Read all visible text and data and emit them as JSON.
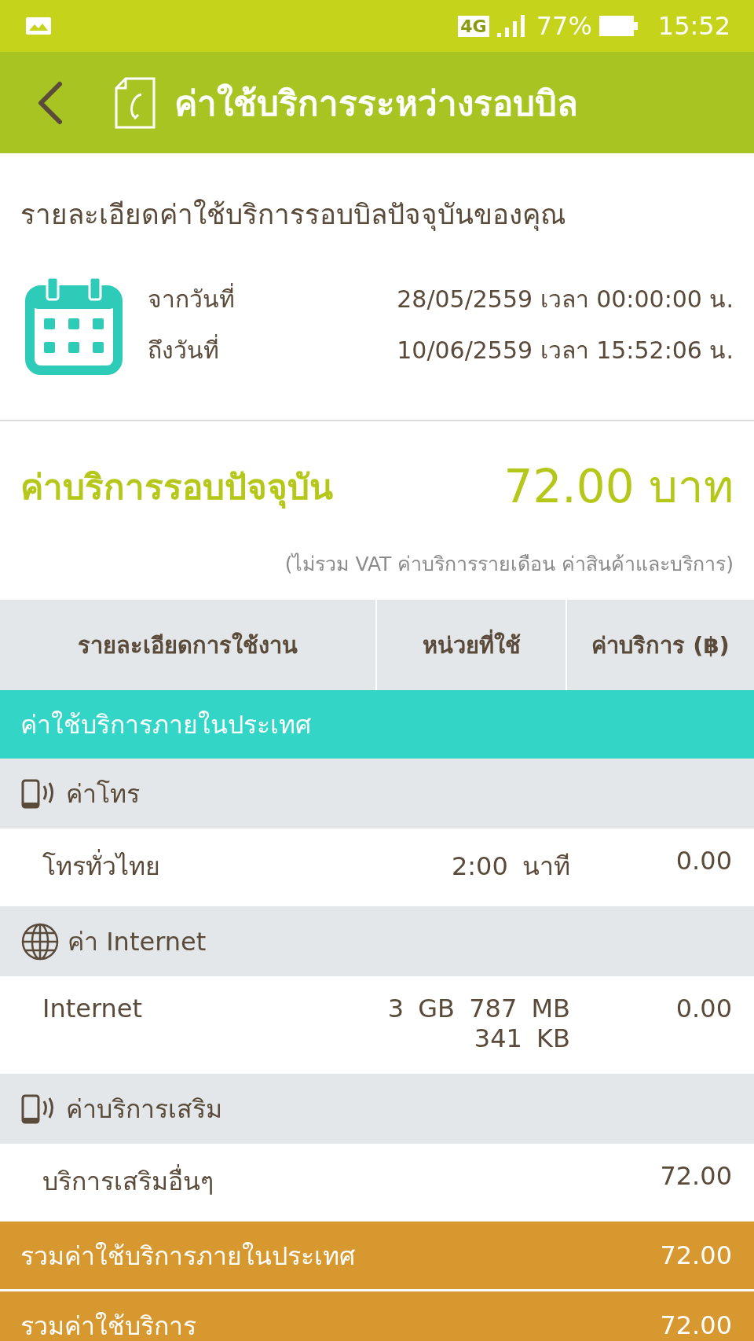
{
  "status_bar": {
    "network": "4G",
    "battery": "77%",
    "time": "15:52"
  },
  "app_bar": {
    "title": "ค่าใช้บริการระหว่างรอบบิล"
  },
  "heading": "รายละเอียดค่าใช้บริการรอบบิลปัจจุบันของคุณ",
  "period": [
    {
      "label": "จากวันที่",
      "value": "28/05/2559 เวลา 00:00:00 น."
    },
    {
      "label": "ถึงวันที่",
      "value": "10/06/2559 เวลา 15:52:06 น."
    }
  ],
  "current_charge": {
    "label": "ค่าบริการรอบปัจจุบัน",
    "amount": "72.00 บาท",
    "note": "(ไม่รวม VAT ค่าบริการรายเดือน ค่าสินค้าและบริการ)"
  },
  "table": {
    "columns": [
      "รายละเอียดการใช้งาน",
      "หน่วยที่ใช้",
      "ค่าบริการ (฿)"
    ],
    "section": "ค่าใช้บริการภายในประเทศ",
    "groups": [
      {
        "kind": "phone",
        "title": "ค่าโทร",
        "rows": [
          {
            "item": "โทรทั่วไทย",
            "units": "2:00 นาที",
            "charge": "0.00"
          }
        ]
      },
      {
        "kind": "globe",
        "title": "ค่า Internet",
        "rows": [
          {
            "item": "Internet",
            "units": "3 GB 787 MB 341 KB",
            "charge": "0.00"
          }
        ]
      },
      {
        "kind": "phone",
        "title": "ค่าบริการเสริม",
        "rows": [
          {
            "item": "บริการเสริมอื่นๆ",
            "charge": "72.00"
          }
        ]
      }
    ],
    "totals": [
      {
        "label": "รวมค่าใช้บริการภายในประเทศ",
        "amount": "72.00"
      },
      {
        "label": "รวมค่าใช้บริการ",
        "amount": "72.00"
      }
    ]
  }
}
